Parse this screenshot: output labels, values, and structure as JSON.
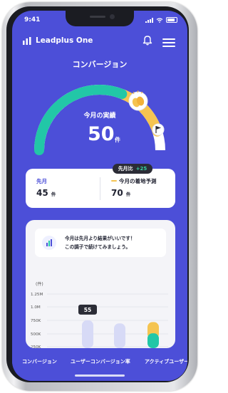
{
  "status": {
    "time": "9:41"
  },
  "header": {
    "brand": "Leadplus One",
    "icons": [
      "logo-icon",
      "bell-icon",
      "menu-icon"
    ]
  },
  "page": {
    "title": "コンバージョン"
  },
  "metric": {
    "label": "今月の実績",
    "value": "50",
    "unit": "件",
    "progress_fraction": 0.62,
    "icons": [
      "clapping-hands-icon",
      "flag-icon"
    ],
    "colors": {
      "achieved": "#22c7a7",
      "forecast": "#f5c451",
      "track": "#ffffff"
    }
  },
  "stats": {
    "badge": {
      "label": "先月比",
      "delta": "+25"
    },
    "previous": {
      "label": "先月",
      "value": "45",
      "unit": "件"
    },
    "forecast": {
      "label": "今月の着地予測",
      "value": "70",
      "unit": "件"
    }
  },
  "message": {
    "line1": "今月は先月より結果がいいです！",
    "line2": "この調子で続けてみましょう。"
  },
  "chart_data": {
    "type": "bar",
    "ylabel": "(件)",
    "y_ticks": [
      "1.25M",
      "1.0M",
      "750K",
      "500K",
      "250K"
    ],
    "categories": [
      "",
      "",
      "",
      ""
    ],
    "values": [
      62,
      55,
      0,
      0
    ],
    "data_labels": [
      "55",
      "",
      "",
      ""
    ],
    "series": [
      {
        "values": [
          62,
          55,
          0,
          48
        ],
        "color": "#d7daf6"
      },
      {
        "values": [
          0,
          0,
          0,
          25
        ],
        "color": "#f5c451"
      },
      {
        "values": [
          0,
          0,
          0,
          33
        ],
        "color": "#22c7a7"
      }
    ],
    "ylim": [
      0,
      130
    ]
  },
  "bottom_tabs": [
    "コンバージョン",
    "ユーザーコンバージョン率",
    "アクティブユーザー"
  ]
}
